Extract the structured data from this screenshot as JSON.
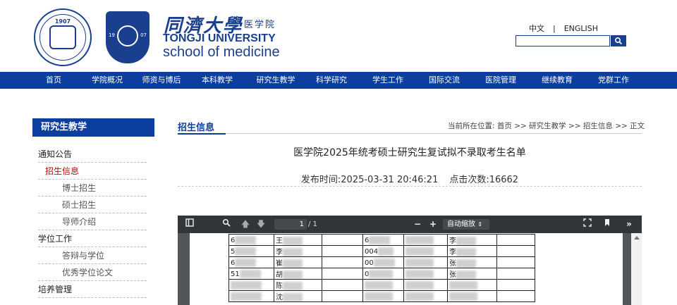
{
  "header": {
    "seal_year": "1907",
    "shield_left": "19",
    "shield_right": "07",
    "school_cn": "同濟大學",
    "school_sub_cn": "医学院",
    "school_en": "TONGJI UNIVERSITY",
    "school_of": "school of medicine",
    "lang_cn": "中文",
    "lang_sep": "|",
    "lang_en": "ENGLISH",
    "search_placeholder": ""
  },
  "nav": [
    "首页",
    "学院概况",
    "师资与博后",
    "本科教学",
    "研究生教学",
    "科学研究",
    "学生工作",
    "国际交流",
    "医院管理",
    "继续教育",
    "党群工作"
  ],
  "sidebar": {
    "title": "研究生教学",
    "items": [
      {
        "label": "通知公告",
        "level": 1
      },
      {
        "label": "招生信息",
        "level": 2
      },
      {
        "label": "博士招生",
        "level": 3
      },
      {
        "label": "硕士招生",
        "level": 3
      },
      {
        "label": "导师介绍",
        "level": 3
      },
      {
        "label": "学位工作",
        "level": 1
      },
      {
        "label": "答辩与学位",
        "level": 3
      },
      {
        "label": "优秀学位论文",
        "level": 3
      },
      {
        "label": "培养管理",
        "level": 1
      }
    ]
  },
  "main": {
    "section_title": "招生信息",
    "breadcrumb": "当前所在位置:  首页 >> 研究生教学 >> 招生信息 >> 正文",
    "article_title": "医学院2025年统考硕士研究生复试拟不录取考生名单",
    "publish": "发布时间:2025-03-31 20:46:21",
    "views": "点击次数:16662"
  },
  "pdf": {
    "page_current": "1",
    "page_total": "/ 1",
    "zoom": "自动缩放",
    "rows": [
      [
        "6",
        "王",
        "",
        "6",
        "李",
        ""
      ],
      [
        "5",
        "李",
        "",
        "004",
        "李",
        ""
      ],
      [
        "6",
        "崔",
        "",
        "00",
        "张",
        ""
      ],
      [
        "51",
        "胡",
        "",
        "0",
        "张",
        ""
      ],
      [
        "",
        "陈",
        "",
        "",
        "",
        ""
      ],
      [
        "",
        "沈",
        "",
        "",
        "",
        ""
      ]
    ]
  },
  "colors": {
    "brand_blue": "#0b3e9e",
    "active_red": "#c00000",
    "pdf_toolbar": "#323639"
  }
}
